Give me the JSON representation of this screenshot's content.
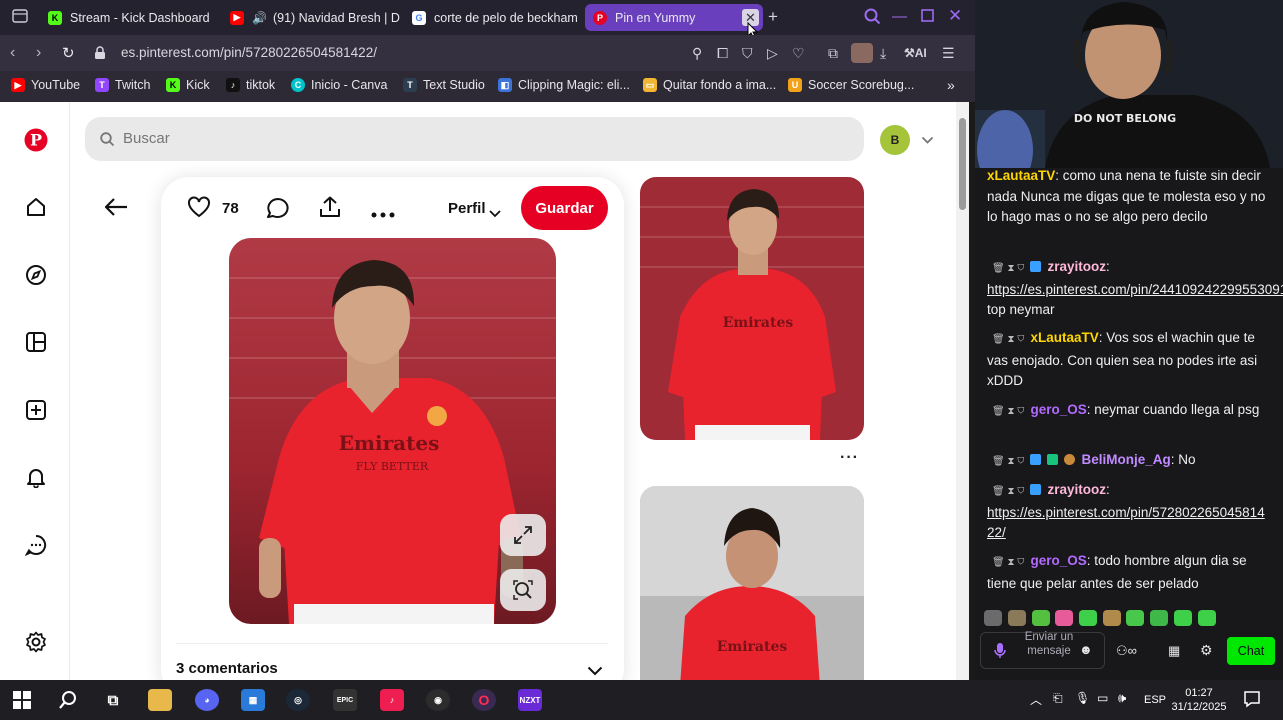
{
  "browser": {
    "tabs": [
      {
        "title": "Stream - Kick Dashboard",
        "icon": "kick-icon",
        "color": "#53fc18"
      },
      {
        "title": "(91) Navidad Bresh | D",
        "icon": "youtube-icon",
        "color": "#ff0000"
      },
      {
        "title": "corte de pelo de beckham",
        "icon": "google-icon",
        "color": "#4285f4"
      },
      {
        "title": "Pin en Yummy",
        "icon": "pinterest-icon",
        "color": "#e60023"
      }
    ],
    "url": "es.pinterest.com/pin/572802265045814​22/",
    "bookmarks": [
      {
        "label": "YouTube",
        "icon": "youtube-icon",
        "color": "#ff0000"
      },
      {
        "label": "Twitch",
        "icon": "twitch-icon",
        "color": "#9146ff"
      },
      {
        "label": "Kick",
        "icon": "kick-icon",
        "color": "#53fc18"
      },
      {
        "label": "tiktok",
        "icon": "tiktok-icon",
        "color": "#111111"
      },
      {
        "label": "Inicio - Canva",
        "icon": "canva-icon",
        "color": "#00c4cc"
      },
      {
        "label": "Text Studio",
        "icon": "text-studio-icon",
        "color": "#2c3e50"
      },
      {
        "label": "Clipping Magic: eli...",
        "icon": "clipping-magic-icon",
        "color": "#3b73d9"
      },
      {
        "label": "Quitar fondo a ima...",
        "icon": "remove-bg-icon",
        "color": "#f2b632"
      },
      {
        "label": "Soccer Scorebug...",
        "icon": "soccer-scorebug-icon",
        "color": "#f1a21b"
      }
    ]
  },
  "pinterest": {
    "search_placeholder": "Buscar",
    "avatar_initial": "B",
    "like_count": "78",
    "profile_label": "Perfil",
    "save_label": "Guardar",
    "comments_label": "3 comentarios",
    "brand_color": "#e60023"
  },
  "chat": {
    "messages": [
      {
        "user": "xLautaaTV",
        "user_color": "#ffd700",
        "text": ": como una nena te fuiste sin decir nada Nunca me digas que te molesta eso y no lo hago mas o no se algo pero decilo"
      },
      {
        "user": "zrayitooz",
        "user_color": "#ffb8d9",
        "text": ":",
        "link": "https://es.pinterest.com/pin/244109242299553091/",
        "after": " top neymar"
      },
      {
        "user": "xLautaaTV",
        "user_color": "#ffd700",
        "text": ": Vos sos el wachin que te vas enojado. Con quien sea no podes irte asi xDDD"
      },
      {
        "user": "gero_OS",
        "user_color": "#b36bff",
        "text": ": neymar cuando llega al psg"
      },
      {
        "user": "BeliMonje_Ag",
        "user_color": "#c18bff",
        "text": ": No"
      },
      {
        "user": "zrayitooz",
        "user_color": "#ffb8d9",
        "text": ":",
        "link": "https://es.pinterest.com/pin/572802265045814​22/",
        "after": ""
      },
      {
        "user": "gero_OS",
        "user_color": "#b36bff",
        "text": ": todo hombre algun dia se tiene que pelar antes de ser pelado"
      }
    ],
    "input_placeholder": "Enviar un mensaje",
    "send_label": "Chat",
    "accent_color": "#00e701"
  },
  "taskbar": {
    "language": "ESP",
    "time": "01:27",
    "date": "31/12/2025"
  }
}
